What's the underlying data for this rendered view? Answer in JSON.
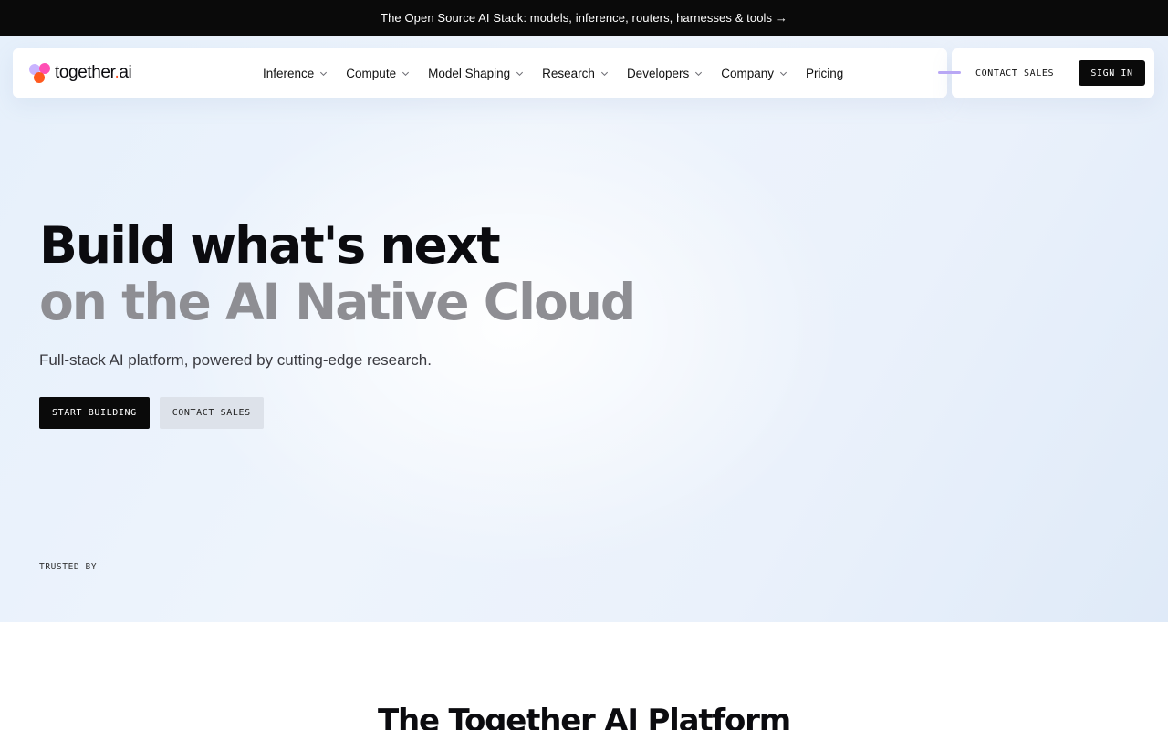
{
  "announcement": {
    "text": "The Open Source AI Stack: models, inference, routers, harnesses & tools →"
  },
  "nav": {
    "logo_text": "together",
    "logo_suffix_dot": ".",
    "logo_suffix": "ai",
    "items": [
      {
        "label": "Inference",
        "has_dropdown": true
      },
      {
        "label": "Compute",
        "has_dropdown": true
      },
      {
        "label": "Model Shaping",
        "has_dropdown": true
      },
      {
        "label": "Research",
        "has_dropdown": true
      },
      {
        "label": "Developers",
        "has_dropdown": true
      },
      {
        "label": "Company",
        "has_dropdown": true
      },
      {
        "label": "Pricing",
        "has_dropdown": false
      }
    ],
    "contact_sales": "CONTACT SALES",
    "sign_in": "SIGN IN"
  },
  "hero": {
    "title_line1": "Build what's next",
    "title_line2": "on the AI Native Cloud",
    "subtitle": "Full-stack AI platform, powered by cutting-edge research.",
    "primary_cta": "START BUILDING",
    "secondary_cta": "CONTACT SALES",
    "trusted_by": "TRUSTED BY"
  },
  "platform": {
    "title": "The Together AI Platform"
  },
  "colors": {
    "announce_bg": "#0a0a0a",
    "accent_orange": "#ff4f1f",
    "accent_pink": "#ff4fb4",
    "accent_lavender": "#c9b4ff",
    "title_gray": "#8e8e93"
  }
}
